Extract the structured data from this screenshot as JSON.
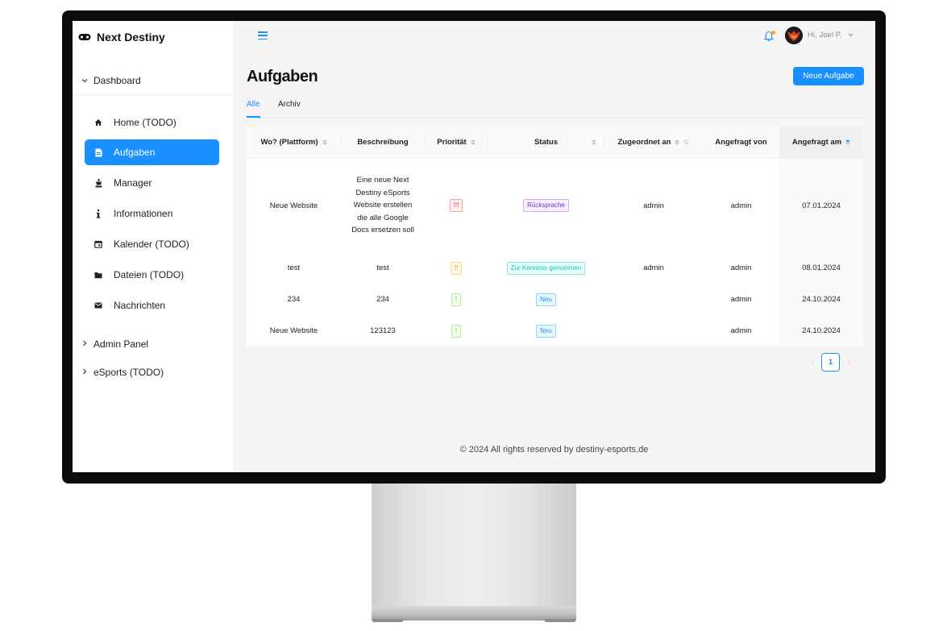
{
  "app": {
    "brand": "Next Destiny"
  },
  "sidebar": {
    "groups": [
      {
        "label": "Dashboard",
        "expanded": true
      },
      {
        "label": "Admin Panel",
        "expanded": false
      },
      {
        "label": "eSports (TODO)",
        "expanded": false
      }
    ],
    "items": [
      {
        "label": "Home (TODO)",
        "icon": "home-icon"
      },
      {
        "label": "Aufgaben",
        "icon": "file-icon",
        "active": true
      },
      {
        "label": "Manager",
        "icon": "chess-king-icon"
      },
      {
        "label": "Informationen",
        "icon": "info-icon"
      },
      {
        "label": "Kalender (TODO)",
        "icon": "calendar-icon"
      },
      {
        "label": "Dateien (TODO)",
        "icon": "folder-icon"
      },
      {
        "label": "Nachrichten",
        "icon": "mail-icon"
      }
    ]
  },
  "header": {
    "greeting": "Hi,",
    "user": "Joel P."
  },
  "page": {
    "title": "Aufgaben",
    "new_button": "Neue Aufgabe",
    "tabs": [
      {
        "label": "Alle",
        "active": true
      },
      {
        "label": "Archiv",
        "active": false
      }
    ]
  },
  "table": {
    "columns": [
      "Wo? (Plattform)",
      "Beschreibung",
      "Priorität",
      "Status",
      "Zugeordnet an",
      "Angefragt von",
      "Angefragt am"
    ],
    "rows": [
      {
        "platform": "Neue Website",
        "description": "Eine neue Next Destiny eSports Website erstellen die alle Google Docs ersetzen soll",
        "priority": "!!!",
        "priority_color": "#f5222d",
        "status": "Rücksprache",
        "status_color": "#722ed1",
        "assigned": "admin",
        "requested_by": "admin",
        "requested_at": "07.01.2024"
      },
      {
        "platform": "test",
        "description": "test",
        "priority": "!!",
        "priority_color": "#fa8c16",
        "status": "Zur Kenntnis genommen",
        "status_color": "#13c2c2",
        "assigned": "admin",
        "requested_by": "admin",
        "requested_at": "08.01.2024"
      },
      {
        "platform": "234",
        "description": "234",
        "priority": "!",
        "priority_color": "#52c41a",
        "status": "Neu",
        "status_color": "#1890ff",
        "assigned": "",
        "requested_by": "admin",
        "requested_at": "24.10.2024"
      },
      {
        "platform": "Neue Website",
        "description": "123123",
        "priority": "!",
        "priority_color": "#52c41a",
        "status": "Neu",
        "status_color": "#1890ff",
        "assigned": "",
        "requested_by": "admin",
        "requested_at": "24.10.2024"
      }
    ]
  },
  "pagination": {
    "current": "1"
  },
  "footer": {
    "text": "© 2024 All rights reserved by destiny-esports.de"
  },
  "colors": {
    "accent": "#1890ff",
    "sidebar_active": "#1890ff"
  }
}
